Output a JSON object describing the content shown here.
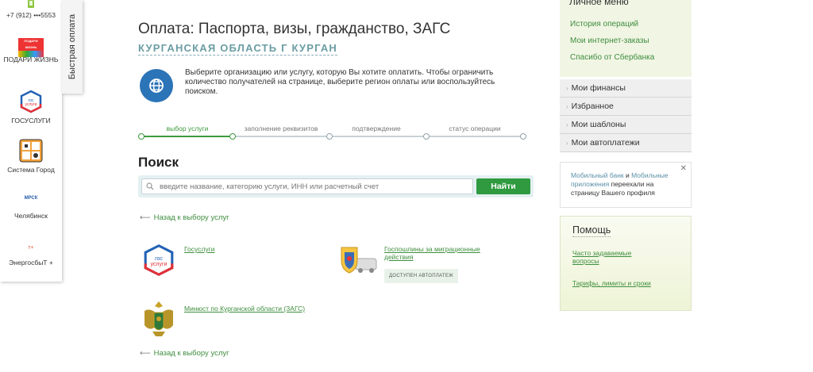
{
  "quick_panel": {
    "tab_label": "Быстрая оплата",
    "items": [
      {
        "label": "+7 (912) •••5553",
        "icon": "phone-icon"
      },
      {
        "label": "ПОДАРИ ЖИЗНЬ",
        "icon": "podari-zhizn-logo",
        "logo_text": "ПОДАРИ ЖИЗНЬ"
      },
      {
        "label": "ГОСУСЛУГИ",
        "icon": "gosuslugi-icon",
        "logo_text": "гос услуги"
      },
      {
        "label": "Система Город",
        "icon": "sistema-gorod-icon"
      },
      {
        "label": "Челябинск",
        "icon": "mrsk-logo-icon",
        "logo_text": "МРСК"
      },
      {
        "label": "ЭнергосбыТ +",
        "icon": "energosbyt-logo-icon",
        "logo_text": "т+"
      }
    ]
  },
  "main": {
    "title": "Оплата: Паспорта, визы, гражданство, ЗАГС",
    "region": "КУРГАНСКАЯ ОБЛАСТЬ Г КУРГАН",
    "info": "Выберите организацию или услугу, которую Вы хотите оплатить. Чтобы ограничить количество получателей на странице, выберите регион оплаты или воспользуйтесь поиском.",
    "steps": [
      "выбор услуги",
      "заполнение реквизитов",
      "подтверждение",
      "статус операции"
    ],
    "active_step": 1,
    "search": {
      "heading": "Поиск",
      "placeholder": "введите название, категорию услуги, ИНН или расчетный счет",
      "button": "Найти"
    },
    "back_link": "Назад к выбору услуг",
    "services": [
      {
        "name": "Госуслуги",
        "icon": "gosuslugi-icon",
        "logo_text": "гос услуги"
      },
      {
        "name": "Госпошлины за миграционные действия",
        "icon": "migration-emblem-icon",
        "badge": "ДОСТУПЕН АВТОПЛАТЕЖ"
      },
      {
        "name": "Минюст по Курганской области (ЗАГС)",
        "icon": "minjust-emblem-icon"
      }
    ]
  },
  "sidebar": {
    "personal_menu_title": "Личное меню",
    "personal_links": [
      "История операций",
      "Мои интернет-заказы",
      "Спасибо от Сбербанка"
    ],
    "menu_items": [
      "Мои финансы",
      "Избранное",
      "Мои шаблоны",
      "Мои автоплатежи"
    ],
    "promo": {
      "link1": "Мобильный банк",
      "conj": " и ",
      "link2": "Мобильные приложения",
      "rest": " переехали на страницу Вашего профиля"
    },
    "help": {
      "title": "Помощь",
      "links": [
        "Часто задаваемые вопросы",
        "Тарифы, лимиты и сроки"
      ]
    }
  },
  "colors": {
    "accent_green": "#2f9a40",
    "link_green": "#3e8e3e",
    "globe_blue": "#2c74b8",
    "region_teal": "#6b9da3"
  }
}
